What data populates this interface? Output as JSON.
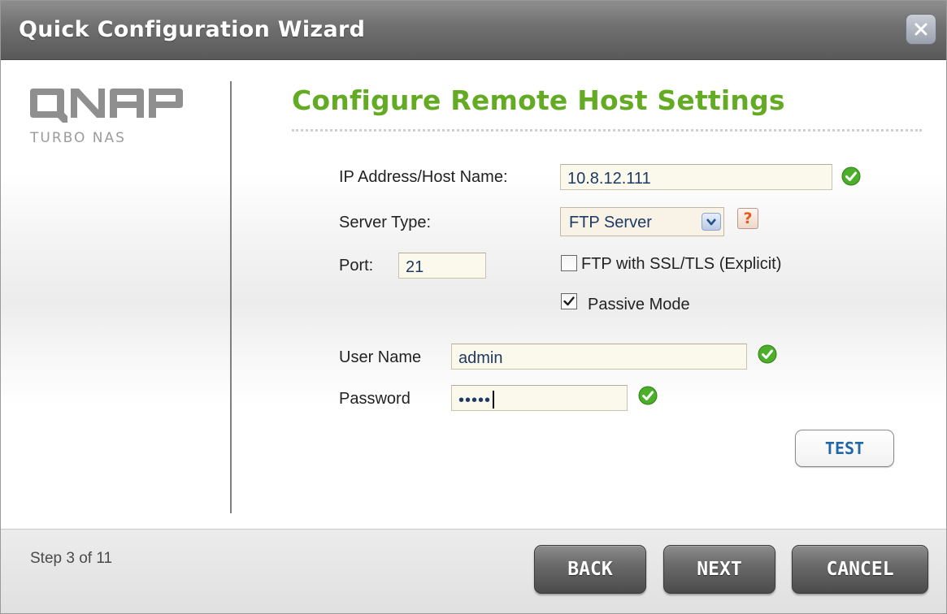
{
  "window": {
    "title": "Quick Configuration Wizard",
    "close_icon": "close-icon"
  },
  "brand": {
    "logo_text": "QNAP",
    "subtitle": "TURBO NAS"
  },
  "main": {
    "heading": "Configure Remote Host Settings",
    "fields": {
      "host_label": "IP Address/Host Name:",
      "host_value": "10.8.12.111",
      "server_type_label": "Server Type:",
      "server_type_value": "FTP Server",
      "port_label": "Port:",
      "port_value": "21",
      "ssl_label": "FTP with SSL/TLS (Explicit)",
      "ssl_checked": false,
      "passive_label": "Passive Mode",
      "passive_checked": true,
      "username_label": "User Name",
      "username_value": "admin",
      "password_label": "Password",
      "password_value": "•••••"
    },
    "help_glyph": "?",
    "test_label": "TEST"
  },
  "footer": {
    "step_text": "Step 3 of 11",
    "back_label": "BACK",
    "next_label": "NEXT",
    "cancel_label": "CANCEL"
  },
  "colors": {
    "heading_green": "#62ab23",
    "valid_check_green": "#4caf2a",
    "help_orange": "#e25a1e",
    "test_blue": "#2368a6"
  }
}
